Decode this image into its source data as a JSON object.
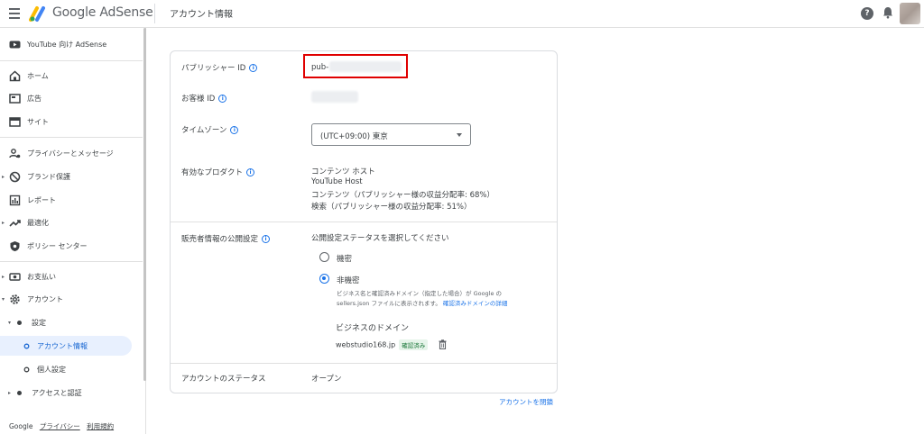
{
  "app": {
    "logo_text": "Google AdSense",
    "page_title": "アカウント情報"
  },
  "sidebar": {
    "youtube": "YouTube 向け AdSense",
    "home": "ホーム",
    "ads": "広告",
    "sites": "サイト",
    "privacy": "プライバシーとメッセージ",
    "brand": "ブランド保護",
    "reports": "レポート",
    "optimize": "最適化",
    "policy": "ポリシー センター",
    "payments": "お支払い",
    "account": "アカウント",
    "settings": "設定",
    "account_info": "アカウント情報",
    "personal": "個人設定",
    "access": "アクセスと認証",
    "footer_google": "Google",
    "footer_privacy": "プライバシー",
    "footer_terms": "利用規約"
  },
  "card": {
    "publisher_id_label": "パブリッシャー ID",
    "publisher_id_value": "pub-",
    "customer_id_label": "お客様 ID",
    "timezone_label": "タイムゾーン",
    "timezone_value": "(UTC+09:00) 東京",
    "products_label": "有効なプロダクト",
    "products": [
      "コンテンツ ホスト",
      "YouTube Host",
      "コンテンツ（パブリッシャー様の収益分配率: 68%）",
      "検索（パブリッシャー様の収益分配率: 51%）"
    ],
    "seller_label": "販売者情報の公開設定",
    "seller_prompt": "公開設定ステータスを選択してください",
    "opt_confidential": "機密",
    "opt_nonconfidential": "非機密",
    "nonconf_desc1": "ビジネス名と確認済みドメイン（指定した場合）が Google の",
    "nonconf_desc2": "sellers.json ファイルに表示されます。",
    "nonconf_link": "確認済みドメインの詳細",
    "domain_heading": "ビジネスのドメイン",
    "domain_value": "webstudio168.jp",
    "domain_badge": "確認済み",
    "status_label": "アカウントのステータス",
    "status_value": "オープン"
  },
  "close_account": "アカウントを閉鎖"
}
